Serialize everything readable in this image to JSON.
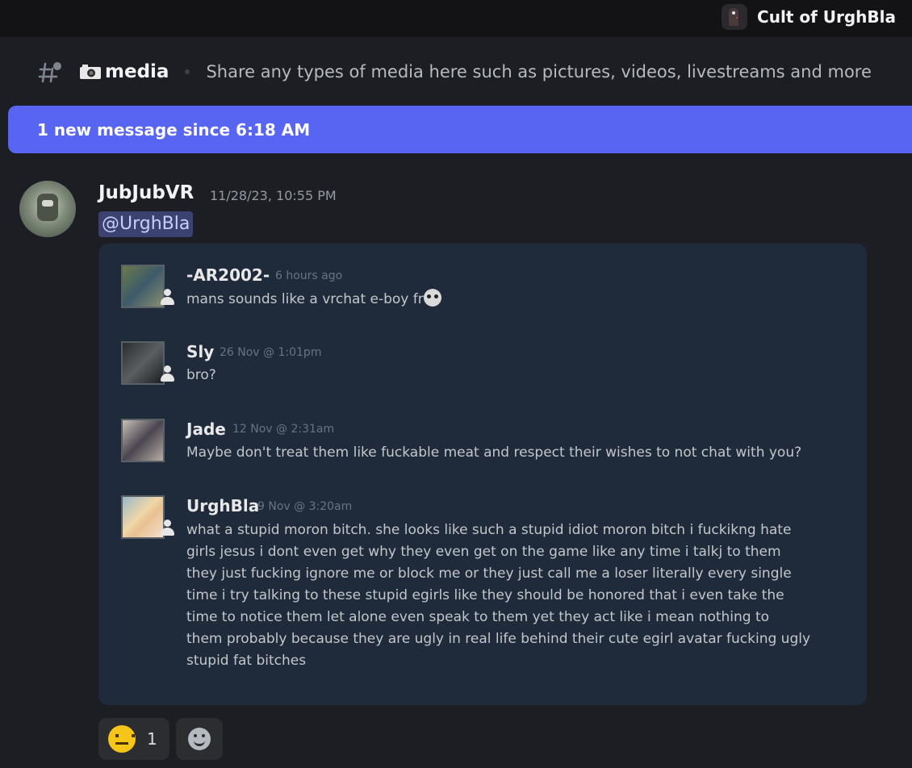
{
  "server": {
    "name": "Cult of UrghBla",
    "icon": "server-icon"
  },
  "channel": {
    "name": "media",
    "topic": "Share any types of media here such as pictures, videos, livestreams and more"
  },
  "banner": {
    "text": "1 new message since 6:18 AM"
  },
  "message": {
    "author": "JubJubVR",
    "timestamp": "11/28/23, 10:55 PM",
    "mention": "@UrghBla"
  },
  "embed": {
    "comments": [
      {
        "author": "-AR2002-",
        "time": "6 hours ago",
        "text": "mans sounds like a vrchat e-boy fr"
      },
      {
        "author": "Sly",
        "time": "26 Nov @ 1:01pm",
        "text": "bro?"
      },
      {
        "author": "Jade",
        "time": "12 Nov @ 2:31am",
        "text": "Maybe don't treat them like fuckable meat and respect their wishes to not chat with you?"
      },
      {
        "author": "UrghBla",
        "time": "9 Nov @ 3:20am",
        "lines": [
          "what a stupid moron bitch. she looks like such a stupid idiot moron bitch i fuckikng hate",
          "girls jesus i dont even get why they even get on the game like any time i talkj to them",
          "they just fucking ignore me or block me or they just call me a loser literally every single",
          "time i try talking to these stupid egirls like they should be honored that i even take the",
          "time to notice them let alone even speak to them yet they act like i mean nothing to",
          "them probably because they are ugly in real life behind their cute egirl avatar fucking ugly",
          "stupid fat bitches"
        ]
      }
    ]
  },
  "reactions": [
    {
      "emoji": "neutral-face-emoji",
      "count": "1"
    }
  ],
  "colors": {
    "accent": "#5865f2",
    "background": "#1d1e23",
    "embed": "#1f2a3a",
    "mention_bg": "#3c4270"
  }
}
